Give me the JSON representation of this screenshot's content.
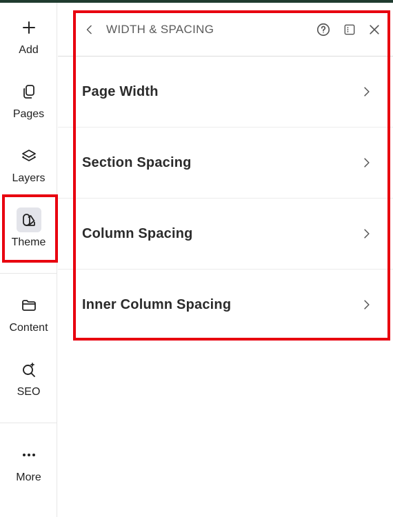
{
  "rail": {
    "items": [
      {
        "label": "Add",
        "icon": "plus-icon"
      },
      {
        "label": "Pages",
        "icon": "pages-icon"
      },
      {
        "label": "Layers",
        "icon": "layers-icon"
      },
      {
        "label": "Theme",
        "icon": "theme-icon",
        "active": true
      },
      {
        "label": "Content",
        "icon": "folder-icon"
      },
      {
        "label": "SEO",
        "icon": "seo-search-icon"
      },
      {
        "label": "More",
        "icon": "more-dots-icon"
      }
    ]
  },
  "panel": {
    "title": "WIDTH & SPACING",
    "rows": [
      {
        "label": "Page Width"
      },
      {
        "label": "Section Spacing"
      },
      {
        "label": "Column Spacing"
      },
      {
        "label": "Inner Column Spacing"
      }
    ]
  },
  "colors": {
    "highlight": "#e8000f",
    "topbar": "#1f3b2f",
    "active_bg": "#e3e4ea"
  }
}
